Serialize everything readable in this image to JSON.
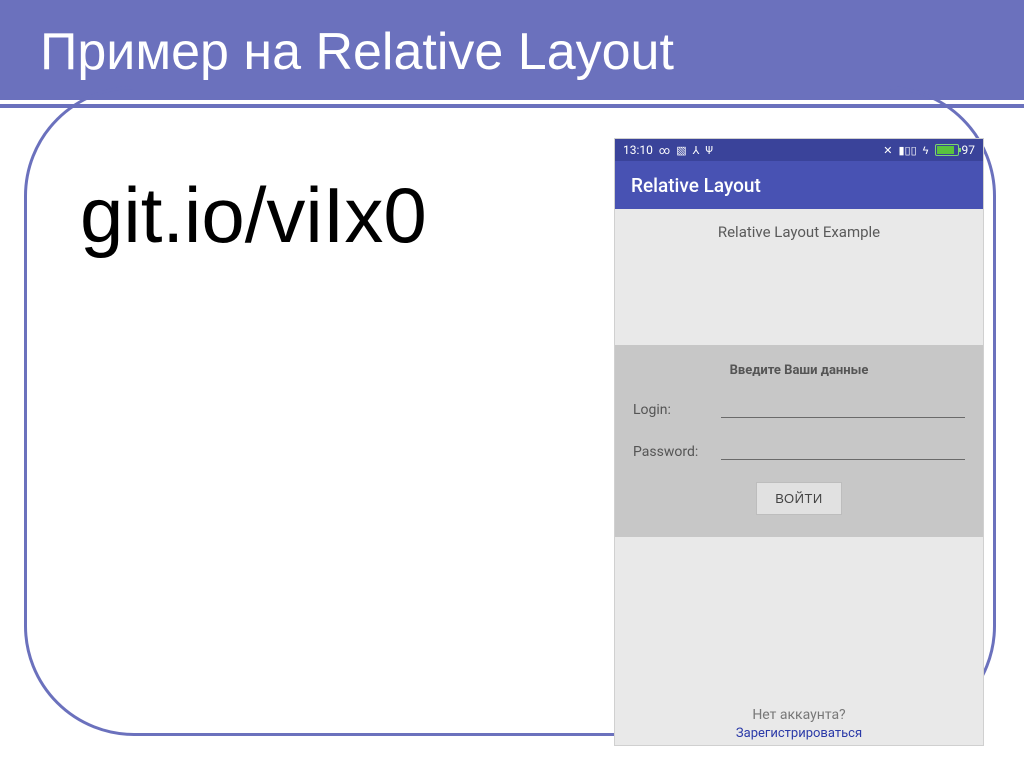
{
  "slide": {
    "title": "Пример на Relative Layout",
    "link": "git.io/viIx0"
  },
  "statusbar": {
    "time": "13:10",
    "battery_level": "97"
  },
  "appbar": {
    "title": "Relative Layout"
  },
  "content": {
    "subtitle": "Relative Layout Example",
    "form_heading": "Введите Ваши данные",
    "login_label": "Login:",
    "password_label": "Password:",
    "submit_label": "ВОЙТИ",
    "no_account": "Нет аккаунта?",
    "register": "Зарегистрироваться"
  }
}
